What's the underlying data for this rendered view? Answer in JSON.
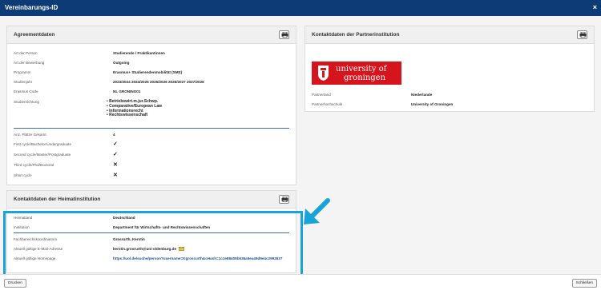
{
  "window": {
    "title": "Vereinbarungs-ID",
    "close_glyph": "×"
  },
  "agreement": {
    "heading": "Agreementdaten",
    "rows": [
      {
        "label": "Art der Person",
        "value": "Studierende / Praktikantinnen"
      },
      {
        "label": "Art der Bewerbung",
        "value": "Outgoing"
      },
      {
        "label": "Programm",
        "value": "Erasmus+ Studierendenmobilität (SMS)"
      },
      {
        "label": "Studienjahr",
        "value": "2023/2024 2024/2025 2025/2026 2026/2027 2027/2028"
      },
      {
        "label": "Erasmus Code",
        "value": "NL GRONING01"
      }
    ],
    "fields_label": "Studienrichtung",
    "fields": [
      "Betriebswirt.m.jur.Schwp.",
      "Comparative/European Law",
      "Informationsrecht",
      "Rechtswissenschaft"
    ],
    "places_label": "Anz. Plätze Gesamt",
    "places_value": "4",
    "cycles": [
      {
        "label": "First cycle/Bachelor/Undergraduate",
        "status": "check"
      },
      {
        "label": "Second cycle/Master/Postgraduate",
        "status": "check"
      },
      {
        "label": "Third cycle/Phd/Doctoral",
        "status": "cross"
      },
      {
        "label": "Short cycle",
        "status": "cross"
      }
    ]
  },
  "home_institution": {
    "heading": "Kontaktdaten der Heimatinstitution",
    "rows": [
      {
        "label": "Heimatland",
        "value": "Deutschland"
      },
      {
        "label": "Institution",
        "value": "Department für Wirtschafts- und Rechtswissenschaften"
      },
      {
        "label": "Fachbereichskoordinatorin",
        "value": "Grosrurth, Kerstin"
      },
      {
        "label": "Aktuell gültige E-Mail-Adresse",
        "value": "kerstin.grosrurth@uni-oldenburg.de"
      },
      {
        "label": "Aktuell gültige Homepage",
        "value": "https://uol.de/suche/person?username=Kgroscurth&cHash=1c1e88408b536a5ea49d9e4c2992637"
      }
    ]
  },
  "partner": {
    "heading": "Kontaktdaten der Partnerinstitution",
    "logo_line1": "university of",
    "logo_line2": "groningen",
    "rows": [
      {
        "label": "Partnerland",
        "value": "Niederlande"
      },
      {
        "label": "Partnerhochschule",
        "value": "University of Groningen"
      }
    ]
  },
  "footer": {
    "print_label": "Drucken",
    "close_label": "Schließen"
  },
  "colors": {
    "titlebar": "#0d3b75",
    "highlight": "#1aa3d8",
    "logo": "#d6141c",
    "check": "#3a9d28",
    "cross": "#c0392b"
  },
  "icons": {
    "print": "printer-icon",
    "close": "close-icon",
    "mail": "envelope-icon",
    "annotation": "arrow-icon"
  }
}
